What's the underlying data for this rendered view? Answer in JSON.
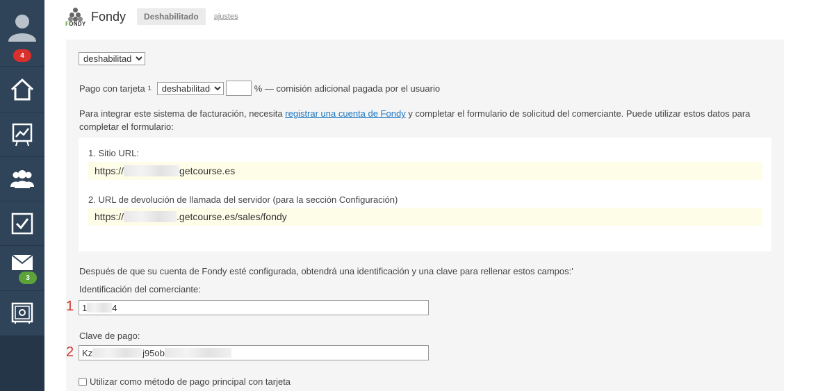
{
  "sidebar": {
    "badges": {
      "notifications": "4",
      "messages": "3"
    }
  },
  "header": {
    "logo_text_a": "F",
    "logo_text_b": "ONDY",
    "title": "Fondy",
    "status": "Deshabilitado",
    "settings_link": "ajustes"
  },
  "form": {
    "main_select": "deshabilitado",
    "card_label": "Pago con tarjeta",
    "card_sup": "1",
    "card_select": "deshabilitado",
    "commission_value": "",
    "commission_text": "% — comisión adicional pagada por el usuario",
    "intro_before": "Para integrar este sistema de facturación, necesita ",
    "intro_link": "registrar una cuenta de Fondy",
    "intro_after": " y completar el formulario de solicitud del comerciante. Puede utilizar estos datos para completar el formulario:",
    "site_url_label": "1. Sitio URL:",
    "site_url_prefix": "https://",
    "site_url_suffix": "getcourse.es",
    "callback_label": "2. URL de devolución de llamada del servidor (para la sección Configuración)",
    "callback_prefix": "https://",
    "callback_suffix": ".getcourse.es/sales/fondy",
    "after_text": "Después de que su cuenta de Fondy esté configurada, obtendrá una identificación y una clave para rellenar estos campos:'",
    "merchant_label": "Identificación del comerciante:",
    "merchant_value_a": "1",
    "merchant_value_b": "4",
    "key_label": "Clave de pago:",
    "key_value_a": "Kz",
    "key_value_b": "j95ob",
    "primary_checkbox_label": "Utilizar como método de pago principal con tarjeta",
    "marker_1": "1",
    "marker_2": "2"
  },
  "colors": {
    "sidebar": "#2f4459",
    "badge_red": "#d9302c",
    "badge_green": "#5ca33a",
    "link": "#1a75c2",
    "highlight": "#fefde8",
    "marker": "#d0342c"
  }
}
